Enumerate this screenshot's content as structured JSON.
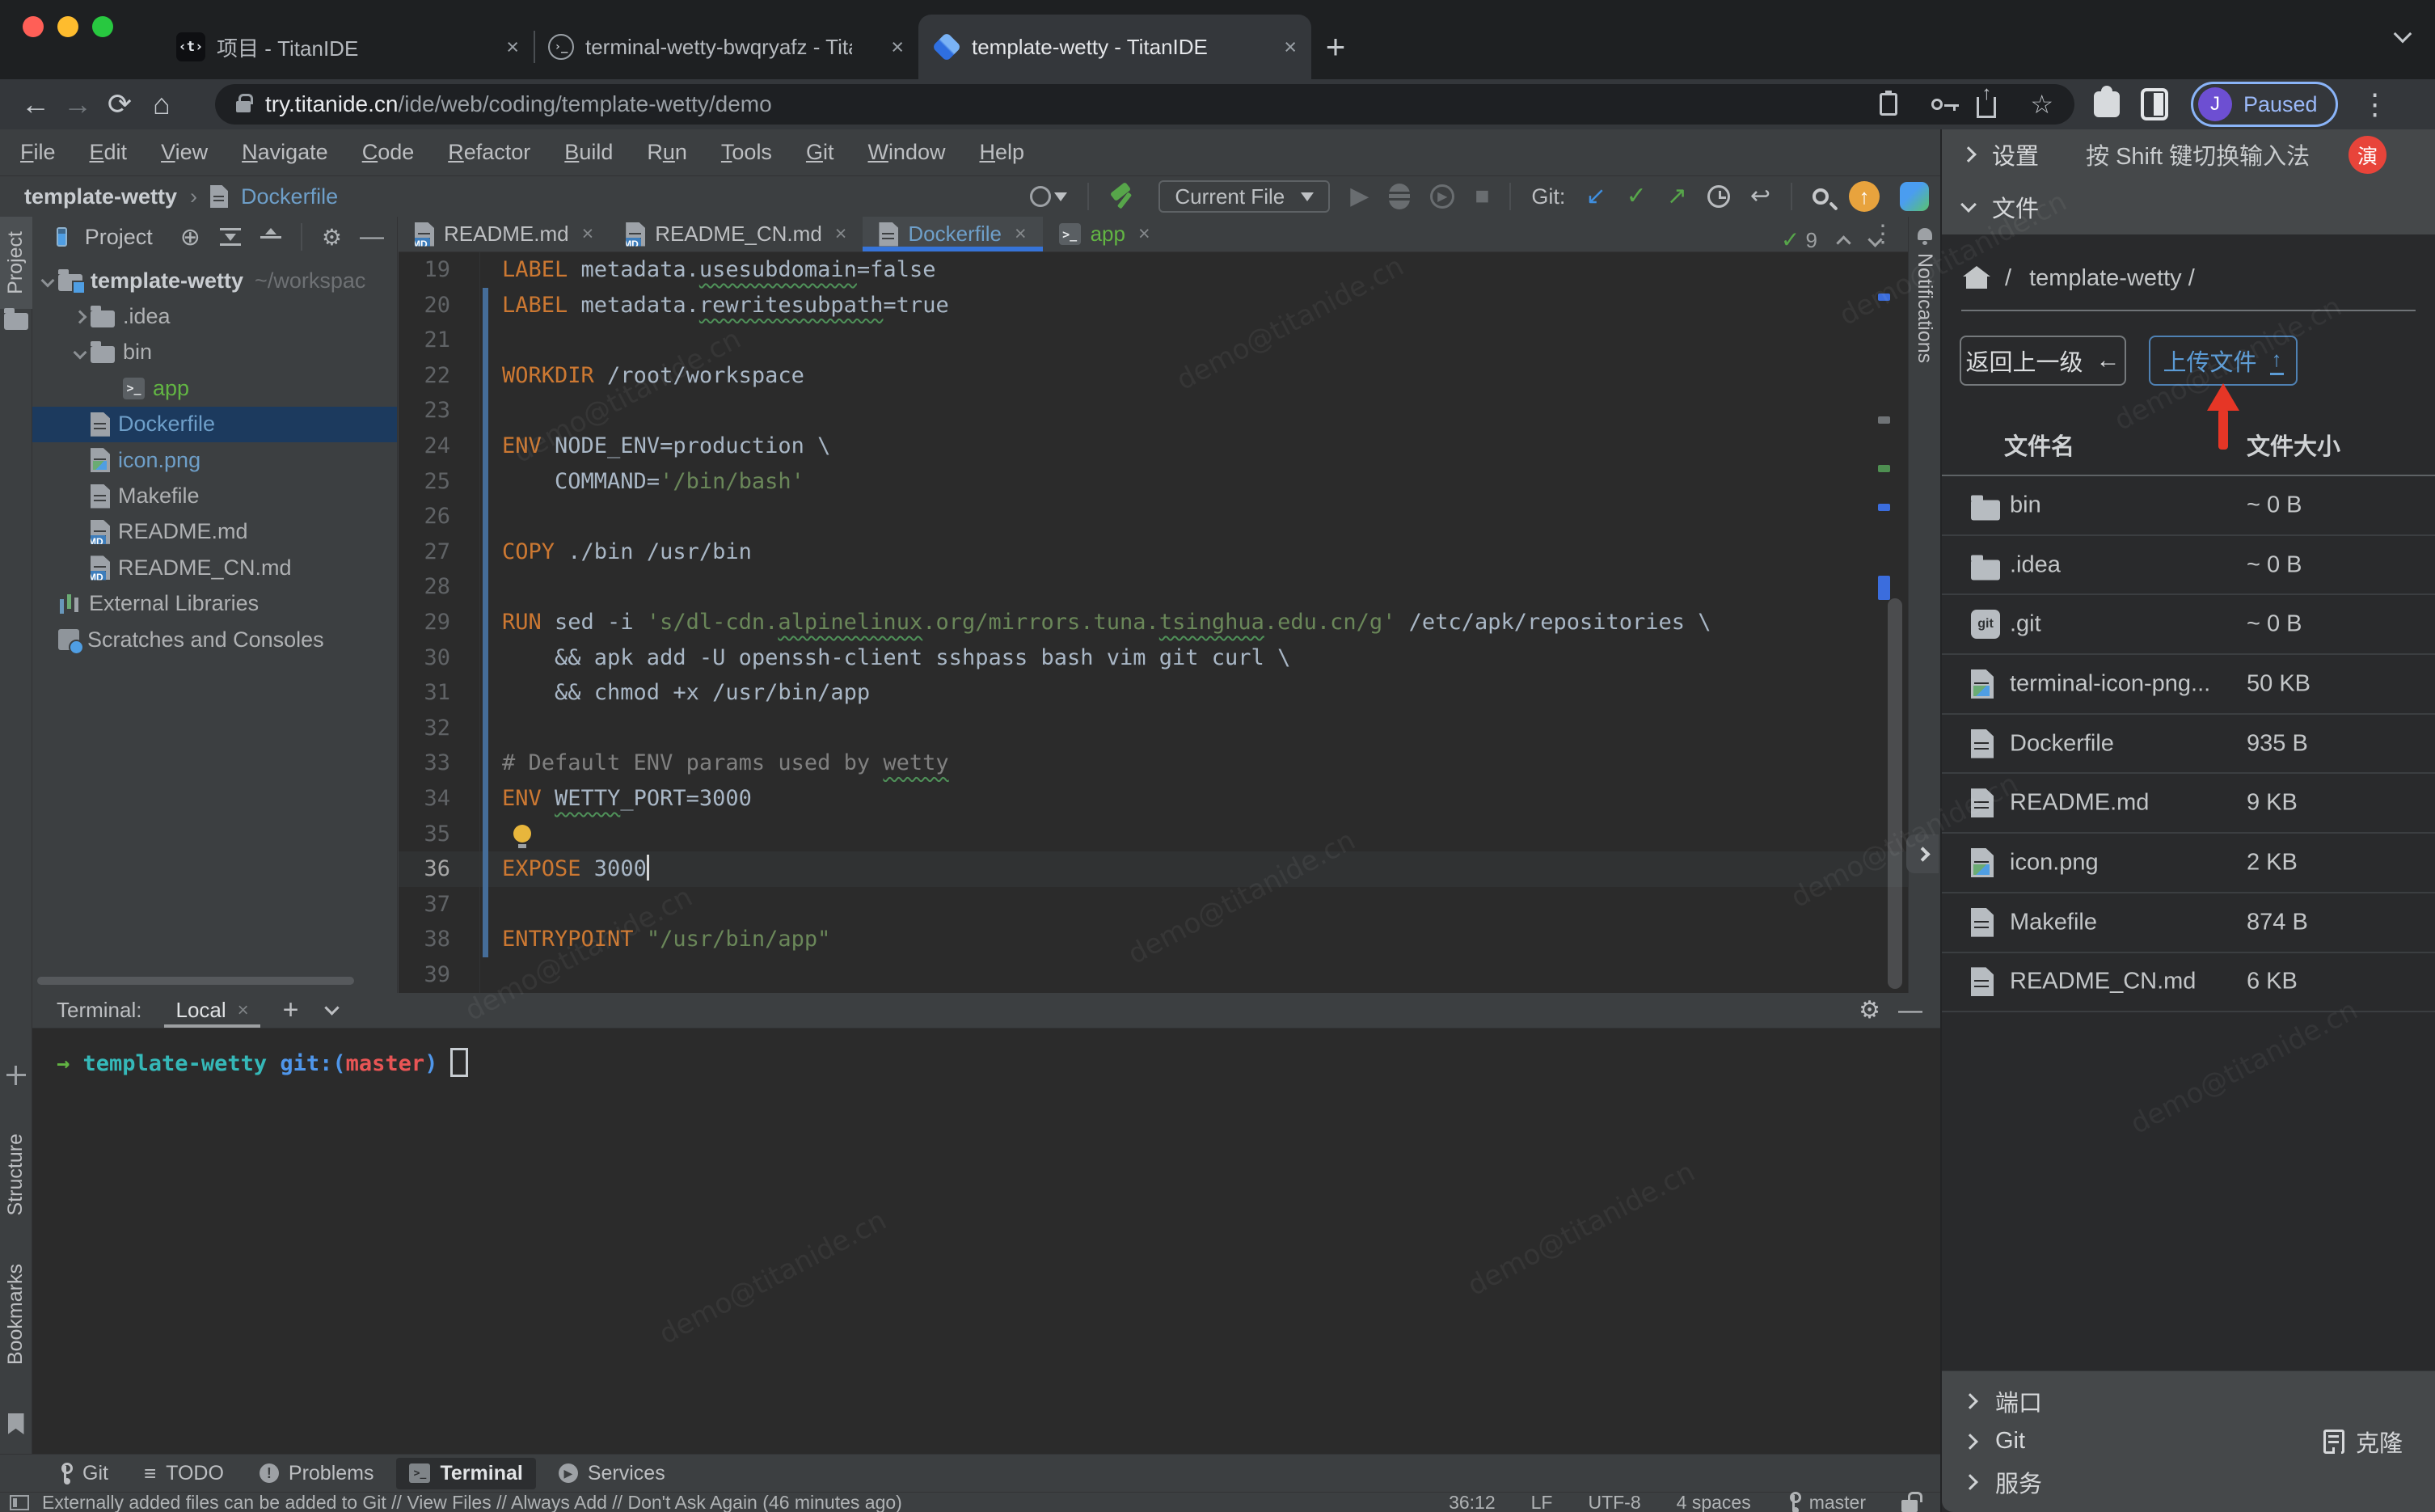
{
  "colors": {
    "accent_blue": "#3674d9",
    "badge_red": "#e8443a",
    "upload_blue": "#5b9bd5",
    "keyword_orange": "#cc7832",
    "string_green": "#6a8759",
    "app_green": "#62b543",
    "modified_blue": "#6e9fc9",
    "traffic_red": "#ff5f57",
    "traffic_yellow": "#febc2e",
    "traffic_green": "#28c840"
  },
  "browser": {
    "tabs": [
      {
        "title": "项目 - TitanIDE",
        "icon": "titan-code-icon",
        "active": false
      },
      {
        "title": "terminal-wetty-bwqryafz - Tita",
        "icon": "terminal-circle-icon",
        "active": false
      },
      {
        "title": "template-wetty - TitanIDE",
        "icon": "titan-gem-icon",
        "active": true
      }
    ],
    "url": {
      "host": "try.titanide.cn",
      "path": "/ide/web/coding/template-wetty/demo"
    },
    "profile": {
      "initial": "J",
      "label": "Paused"
    }
  },
  "menubar": [
    {
      "label": "File",
      "u": 0
    },
    {
      "label": "Edit",
      "u": 0
    },
    {
      "label": "View",
      "u": 0
    },
    {
      "label": "Navigate",
      "u": 0
    },
    {
      "label": "Code",
      "u": 0
    },
    {
      "label": "Refactor",
      "u": 0
    },
    {
      "label": "Build",
      "u": 0
    },
    {
      "label": "Run",
      "u": 1
    },
    {
      "label": "Tools",
      "u": 0
    },
    {
      "label": "Git",
      "u": 0
    },
    {
      "label": "Window",
      "u": 0
    },
    {
      "label": "Help",
      "u": 0
    }
  ],
  "breadcrumb": {
    "project": "template-wetty",
    "file": "Dockerfile"
  },
  "toolbar": {
    "run_config": "Current File",
    "git_label": "Git:"
  },
  "left_strip": {
    "project": "Project",
    "structure": "Structure",
    "bookmarks": "Bookmarks"
  },
  "right_strip": {
    "label": "Notifications"
  },
  "project": {
    "title": "Project",
    "tree": [
      {
        "label": "template-wetty",
        "annotation": "~/workspac",
        "icon": "project",
        "level": 0,
        "chevron": "down",
        "bold": true
      },
      {
        "label": ".idea",
        "icon": "folder",
        "level": 1,
        "chevron": "right"
      },
      {
        "label": "bin",
        "icon": "folder",
        "level": 1,
        "chevron": "down"
      },
      {
        "label": "app",
        "icon": "terminal",
        "level": 2,
        "green": true
      },
      {
        "label": "Dockerfile",
        "icon": "file",
        "level": 1,
        "selected": true,
        "modified": true
      },
      {
        "label": "icon.png",
        "icon": "image",
        "level": 1,
        "modified": true
      },
      {
        "label": "Makefile",
        "icon": "file",
        "level": 1
      },
      {
        "label": "README.md",
        "icon": "md",
        "level": 1
      },
      {
        "label": "README_CN.md",
        "icon": "md",
        "level": 1
      },
      {
        "label": "External Libraries",
        "icon": "lib",
        "level": 0
      },
      {
        "label": "Scratches and Consoles",
        "icon": "scratch",
        "level": 0
      }
    ]
  },
  "editor": {
    "tabs": [
      {
        "label": "README.md",
        "icon": "md"
      },
      {
        "label": "README_CN.md",
        "icon": "md"
      },
      {
        "label": "Dockerfile",
        "icon": "file",
        "active": true
      },
      {
        "label": "app",
        "icon": "terminal",
        "green": true
      }
    ],
    "inspection_count": "9",
    "lines": [
      {
        "n": 19,
        "t": [
          [
            "k",
            "LABEL"
          ],
          [
            "p",
            " metadata."
          ],
          [
            "pw",
            "usesubdomain"
          ],
          [
            "p",
            "=false"
          ]
        ]
      },
      {
        "n": 20,
        "t": [
          [
            "k",
            "LABEL"
          ],
          [
            "p",
            " metadata."
          ],
          [
            "pw",
            "rewritesubpath"
          ],
          [
            "p",
            "=true"
          ]
        ]
      },
      {
        "n": 21,
        "t": []
      },
      {
        "n": 22,
        "t": [
          [
            "k",
            "WORKDIR"
          ],
          [
            "p",
            " /root/workspace"
          ]
        ]
      },
      {
        "n": 23,
        "t": []
      },
      {
        "n": 24,
        "t": [
          [
            "k",
            "ENV"
          ],
          [
            "p",
            " NODE_ENV=production \\"
          ]
        ]
      },
      {
        "n": 25,
        "t": [
          [
            "p",
            "    COMMAND="
          ],
          [
            "s",
            "'/bin/bash'"
          ]
        ]
      },
      {
        "n": 26,
        "t": []
      },
      {
        "n": 27,
        "t": [
          [
            "k",
            "COPY"
          ],
          [
            "p",
            " ./bin /usr/bin"
          ]
        ]
      },
      {
        "n": 28,
        "t": []
      },
      {
        "n": 29,
        "t": [
          [
            "k",
            "RUN"
          ],
          [
            "p",
            " sed -i "
          ],
          [
            "s",
            "'s/dl-cdn."
          ],
          [
            "sw",
            "alpinelinux"
          ],
          [
            "s",
            ".org/mirrors.tuna."
          ],
          [
            "sw",
            "tsinghua"
          ],
          [
            "s",
            ".edu.cn/g'"
          ],
          [
            "p",
            " /etc/apk/repositories \\"
          ]
        ]
      },
      {
        "n": 30,
        "t": [
          [
            "p",
            "    && apk add -U openssh-client sshpass bash vim git curl \\"
          ]
        ]
      },
      {
        "n": 31,
        "t": [
          [
            "p",
            "    && chmod +x /usr/bin/app"
          ]
        ]
      },
      {
        "n": 32,
        "t": []
      },
      {
        "n": 33,
        "t": [
          [
            "c",
            "# Default ENV params used by "
          ],
          [
            "cw",
            "wetty"
          ]
        ]
      },
      {
        "n": 34,
        "t": [
          [
            "k",
            "ENV"
          ],
          [
            "p",
            " "
          ],
          [
            "pw",
            "WETTY"
          ],
          [
            "p",
            "_PORT=3000"
          ]
        ]
      },
      {
        "n": 35,
        "t": [],
        "bulb": true
      },
      {
        "n": 36,
        "t": [
          [
            "k",
            "EXPOSE"
          ],
          [
            "p",
            " 3000"
          ]
        ],
        "current": true,
        "cursor": true
      },
      {
        "n": 37,
        "t": []
      },
      {
        "n": 38,
        "t": [
          [
            "k",
            "ENTRYPOINT"
          ],
          [
            "p",
            " "
          ],
          [
            "s",
            "\"/usr/bin/app\""
          ]
        ]
      },
      {
        "n": 39,
        "t": []
      }
    ]
  },
  "terminal": {
    "label": "Terminal:",
    "tab": "Local",
    "prompt": [
      {
        "text": "→",
        "color": "#62b543"
      },
      {
        "text": "  template-wetty ",
        "color": "#35b8b8"
      },
      {
        "text": "git:(",
        "color": "#4f96ea"
      },
      {
        "text": "master",
        "color": "#e85555"
      },
      {
        "text": ")",
        "color": "#4f96ea"
      }
    ]
  },
  "tool_buttons": [
    {
      "label": "Git",
      "icon": "branch"
    },
    {
      "label": "TODO",
      "icon": "list"
    },
    {
      "label": "Problems",
      "icon": "error"
    },
    {
      "label": "Terminal",
      "icon": "terminal",
      "active": true
    },
    {
      "label": "Services",
      "icon": "services"
    }
  ],
  "status": {
    "message": "Externally added files can be added to Git // View Files // Always Add // Don't Ask Again (46 minutes ago)",
    "items": [
      {
        "label": "36:12"
      },
      {
        "label": "LF"
      },
      {
        "label": "UTF-8"
      },
      {
        "label": "4 spaces"
      },
      {
        "label": "master",
        "icon": "branch"
      },
      {
        "label": "",
        "icon": "unlock"
      }
    ]
  },
  "right_panel": {
    "settings": "设置",
    "ime_hint": "按 Shift 键切换输入法",
    "badge": "演",
    "files_section": "文件",
    "path_project": "template-wetty /",
    "back_button": "返回上一级",
    "upload_button": "上传文件",
    "columns": {
      "name": "文件名",
      "size": "文件大小"
    },
    "rows": [
      {
        "name": "bin",
        "size": "~ 0 B",
        "icon": "folder"
      },
      {
        "name": ".idea",
        "size": "~ 0 B",
        "icon": "folder"
      },
      {
        "name": ".git",
        "size": "~ 0 B",
        "icon": "git"
      },
      {
        "name": "terminal-icon-png...",
        "size": "50 KB",
        "icon": "image"
      },
      {
        "name": "Dockerfile",
        "size": "935 B",
        "icon": "file"
      },
      {
        "name": "README.md",
        "size": "9 KB",
        "icon": "file"
      },
      {
        "name": "icon.png",
        "size": "2 KB",
        "icon": "image"
      },
      {
        "name": "Makefile",
        "size": "874 B",
        "icon": "file"
      },
      {
        "name": "README_CN.md",
        "size": "6 KB",
        "icon": "file"
      }
    ],
    "sections": {
      "ports": "端口",
      "git": "Git",
      "clone": "克隆",
      "services": "服务"
    }
  },
  "watermark": "demo@titanide.cn"
}
